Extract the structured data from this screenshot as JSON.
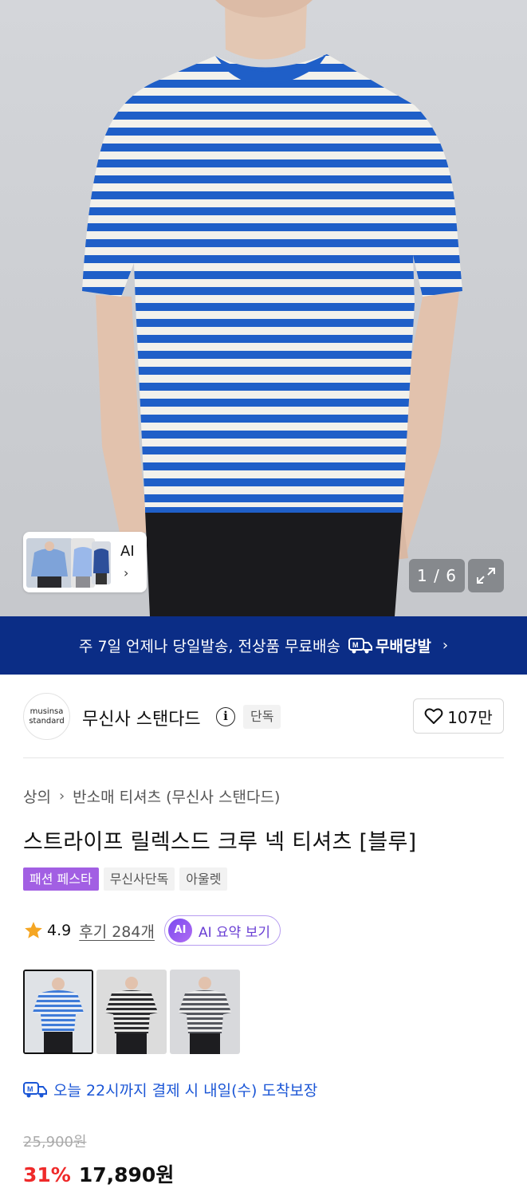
{
  "hero": {
    "ai_label": "AI",
    "page_indicator": "1 / 6"
  },
  "banner": {
    "text": "주 7일 언제나 당일발송, 전상품 무료배송",
    "brand": "무배당발"
  },
  "brand": {
    "logo_line1": "musinsa",
    "logo_line2": "standard",
    "name": "무신사 스탠다드",
    "badge": "단독",
    "likes": "107만"
  },
  "product": {
    "breadcrumb": [
      "상의",
      "반소매 티셔츠 (무신사 스탠다드)"
    ],
    "title": "스트라이프 릴렉스드 크루 넥 티셔츠 [블루]",
    "tags": [
      "패션 페스타",
      "무신사단독",
      "아울렛"
    ],
    "rating": "4.9",
    "reviews": "후기 284개",
    "ai_summary": "AI 요약 보기",
    "ai_badge": "AI",
    "delivery": "오늘 22시까지 결제 시 내일(수) 도착보장",
    "original_price": "25,900원",
    "discount": "31%",
    "price": "17,890원"
  },
  "colors": {
    "stripe_blue": "#1f5fc8",
    "banner_bg": "#0b2d86",
    "discount_red": "#ef2a2a",
    "delivery_blue": "#1b56d6",
    "fest_purple": "#a25fe3"
  }
}
